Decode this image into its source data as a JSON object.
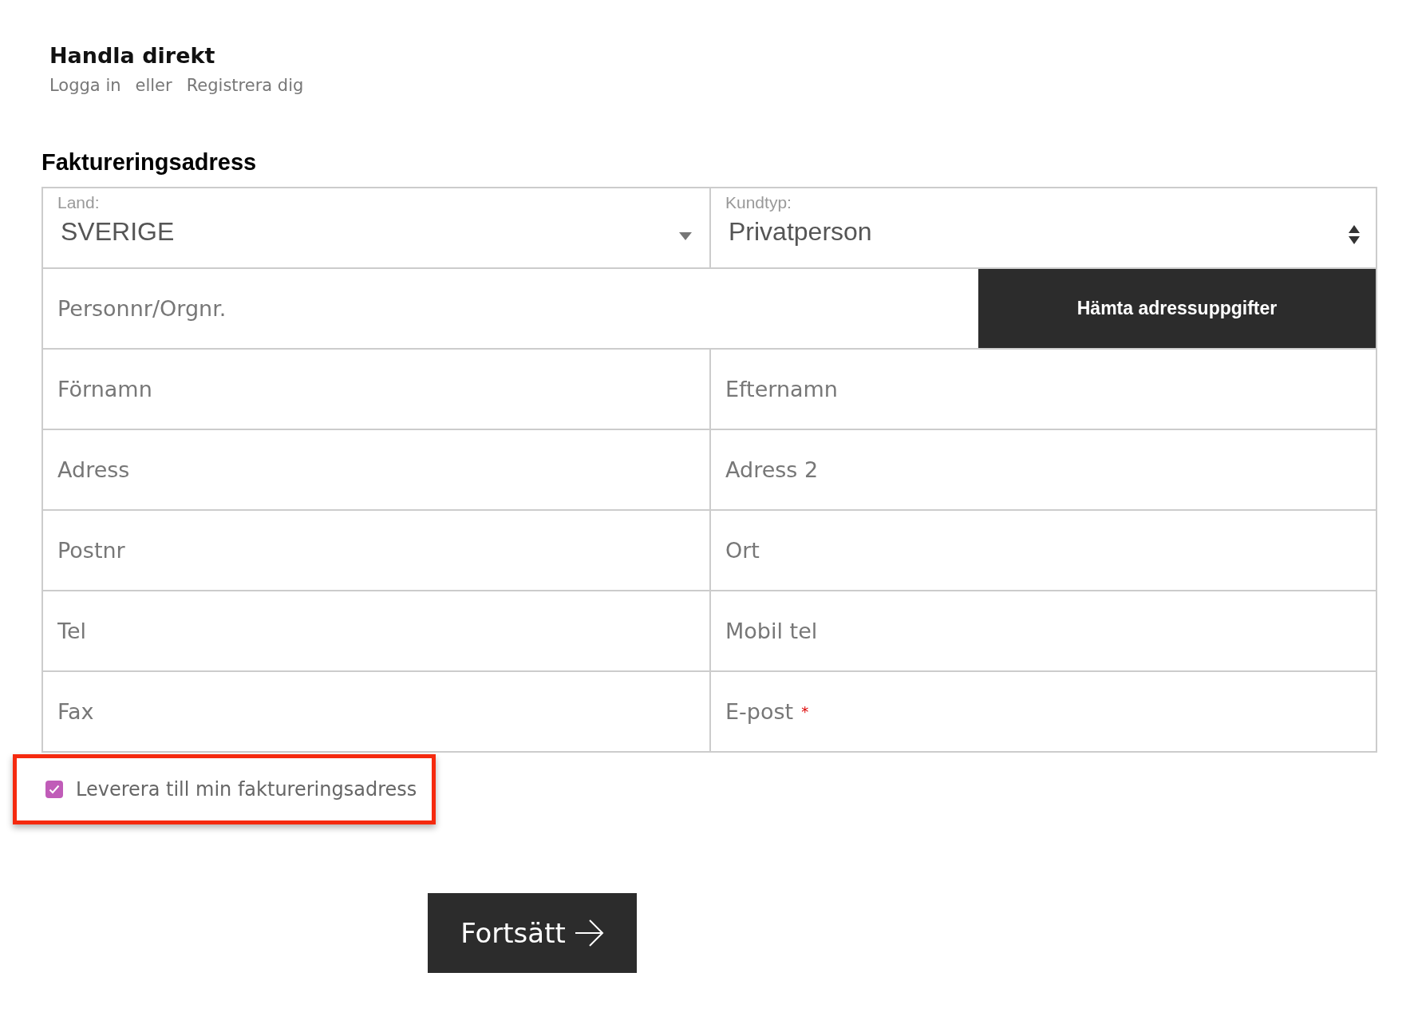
{
  "header": {
    "title": "Handla direkt",
    "links": [
      "Logga in",
      "eller",
      "Registrera dig"
    ]
  },
  "section_title": "Faktureringsadress",
  "selects": [
    {
      "label": "Land:",
      "value": "SVERIGE",
      "kind": "dropdown"
    },
    {
      "label": "Kundtyp:",
      "value": "Privatperson",
      "kind": "spinner"
    }
  ],
  "lookup": {
    "placeholder": "Personnr/Orgnr.",
    "button": "Hämta adressuppgifter"
  },
  "rows": [
    {
      "fields": [
        {
          "placeholder": "Förnamn"
        },
        {
          "placeholder": "Efternamn"
        }
      ]
    },
    {
      "fields": [
        {
          "placeholder": "Adress"
        },
        {
          "placeholder": "Adress 2"
        }
      ]
    },
    {
      "fields": [
        {
          "placeholder": "Postnr"
        },
        {
          "placeholder": "Ort"
        }
      ]
    },
    {
      "fields": [
        {
          "placeholder": "Tel"
        },
        {
          "placeholder": "Mobil tel"
        }
      ]
    },
    {
      "fields": [
        {
          "placeholder": "Fax"
        },
        {
          "placeholder": "E-post",
          "required_mark": "*"
        }
      ]
    }
  ],
  "delivery": {
    "label": "Leverera till min faktureringsadress",
    "checked": true,
    "highlighted": true
  },
  "continue_button": "Fortsätt"
}
